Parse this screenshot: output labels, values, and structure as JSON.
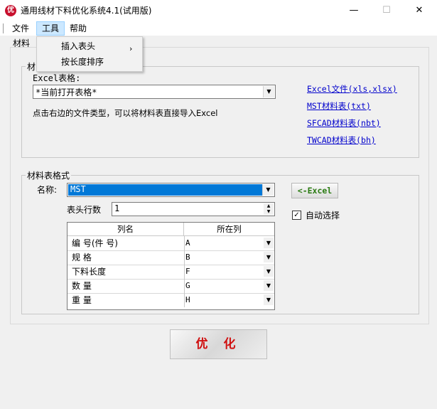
{
  "window": {
    "title": "通用线材下料优化系统4.1(试用版)",
    "icon_glyph": "优",
    "minimize": "—",
    "maximize": "☐",
    "close": "✕"
  },
  "menu": {
    "file": "文件",
    "tools": "工具",
    "help": "帮助",
    "tools_items": [
      "插入表头",
      "按长度排序"
    ],
    "submenu_arrow": "›"
  },
  "tab": {
    "label": "材料"
  },
  "group1": {
    "title": "材",
    "excel_label": "Excel表格:",
    "excel_value": "*当前打开表格*",
    "hint": "点击右边的文件类型，可以将材料表直接导入Excel",
    "links": [
      "Excel文件(xls,xlsx)",
      "MST材料表(txt)",
      "SFCAD材料表(nbt)",
      "TWCAD材料表(bh)"
    ]
  },
  "group2": {
    "title": "材料表格式",
    "name_label": "名称:",
    "name_value": "MST",
    "excel_button": "<-Excel",
    "header_rows_label": "表头行数",
    "header_rows_value": "1",
    "auto_select_label": "自动选择",
    "auto_select_checked": true
  },
  "grid": {
    "headers": [
      "列名",
      "所在列"
    ],
    "rows": [
      {
        "name": "编 号(件 号)",
        "col": "A"
      },
      {
        "name": "规  格",
        "col": "B"
      },
      {
        "name": "下料长度",
        "col": "F"
      },
      {
        "name": "数  量",
        "col": "G"
      },
      {
        "name": "重  量",
        "col": "H"
      }
    ]
  },
  "optimize_button": "优 化",
  "colors": {
    "link": "#0000cc",
    "excel_button_text": "#2a7a12",
    "optimize_text": "#d01010",
    "selection": "#0078d7"
  }
}
